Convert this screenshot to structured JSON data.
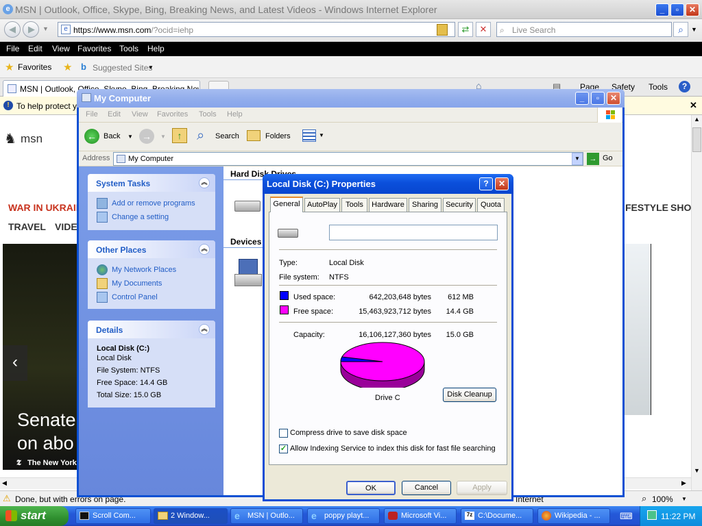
{
  "ie": {
    "title": "MSN | Outlook, Office, Skype, Bing, Breaking News, and Latest Videos - Windows Internet Explorer",
    "url_host": "https://www.msn.com",
    "url_path": "/?ocid=iehp",
    "search_placeholder": "Live Search",
    "menu": [
      "File",
      "Edit",
      "View",
      "Favorites",
      "Tools",
      "Help"
    ],
    "favorites_label": "Favorites",
    "suggested_sites": "Suggested Sites",
    "tab_title": "MSN | Outlook, Office, Skype, Bing, Breaking News",
    "cmd": [
      "Page",
      "Safety",
      "Tools"
    ],
    "infobar": "To help protect yo",
    "status": "Done, but with errors on page.",
    "status_zone": "Internet",
    "zoom": "100%"
  },
  "msn": {
    "logo_text": "msn",
    "nav_war": "WAR IN UKRAIN",
    "nav_travel": "TRAVEL",
    "nav_video": "VIDEO",
    "nav_lifestyle": "FESTYLE",
    "nav_shop": "SHO",
    "headline_1": "Senate",
    "headline_2": "on abo",
    "source": "The New York"
  },
  "mycomputer": {
    "title": "My Computer",
    "menu": [
      "File",
      "Edit",
      "View",
      "Favorites",
      "Tools",
      "Help"
    ],
    "back": "Back",
    "search": "Search",
    "folders": "Folders",
    "address_label": "Address",
    "address_value": "My Computer",
    "go": "Go",
    "system_tasks": {
      "title": "System Tasks",
      "links": [
        "Add or remove programs",
        "Change a setting"
      ]
    },
    "other_places": {
      "title": "Other Places",
      "links": [
        "My Network Places",
        "My Documents",
        "Control Panel"
      ]
    },
    "details": {
      "title": "Details",
      "name": "Local Disk (C:)",
      "type": "Local Disk",
      "fs": "File System: NTFS",
      "free": "Free Space: 14.4 GB",
      "total": "Total Size: 15.0 GB"
    },
    "group_hard_disks": "Hard Disk Drives",
    "group_devices": "Devices"
  },
  "dialog": {
    "title": "Local Disk (C:) Properties",
    "tabs": [
      "General",
      "AutoPlay",
      "Tools",
      "Hardware",
      "Sharing",
      "Security",
      "Quota"
    ],
    "label_value": "",
    "type_label": "Type:",
    "type_value": "Local Disk",
    "fs_label": "File system:",
    "fs_value": "NTFS",
    "used_label": "Used space:",
    "used_bytes": "642,203,648 bytes",
    "used_short": "612 MB",
    "free_label": "Free space:",
    "free_bytes": "15,463,923,712 bytes",
    "free_short": "14.4 GB",
    "capacity_label": "Capacity:",
    "capacity_bytes": "16,106,127,360 bytes",
    "capacity_short": "15.0 GB",
    "drive_label": "Drive C",
    "disk_cleanup": "Disk Cleanup",
    "compress_label": "Compress drive to save disk space",
    "compress_checked": false,
    "index_label": "Allow Indexing Service to index this disk for fast file searching",
    "index_checked": true,
    "ok": "OK",
    "cancel": "Cancel",
    "apply": "Apply",
    "used_color": "#0000ff",
    "free_color": "#ff00ff",
    "used_fraction": 0.04
  },
  "taskbar": {
    "start": "start",
    "tasks": [
      "Scroll Com...",
      "2 Window...",
      "MSN | Outlo...",
      "poppy playt...",
      "Microsoft Vi...",
      "C:\\Docume...",
      "Wikipedia - ..."
    ],
    "clock": "11:22 PM"
  }
}
